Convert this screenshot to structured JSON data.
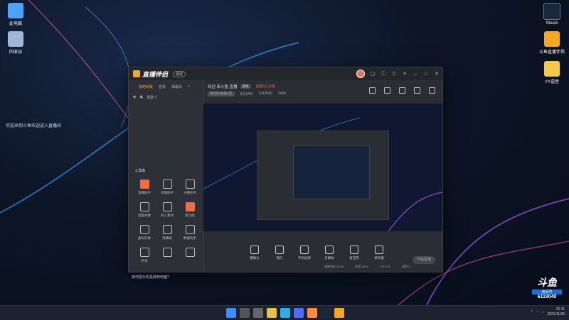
{
  "desktop": {
    "icons_left": [
      {
        "label": "此电脑",
        "icon": "computer-icon",
        "color": "#4aa3ff"
      },
      {
        "label": "回收站",
        "icon": "recycle-bin-icon",
        "color": "#9fb8d8"
      }
    ],
    "icons_right": [
      {
        "label": "Steam",
        "icon": "steam-icon",
        "color": "#1b2838"
      },
      {
        "label": "斗鱼直播伴侣",
        "icon": "douyu-icon",
        "color": "#f5a623"
      },
      {
        "label": "YY语音",
        "icon": "yy-icon",
        "color": "#f6c945"
      }
    ],
    "welcome_text": "欢迎来到斗鱼欢迎进入直播间"
  },
  "app": {
    "title": "直播伴侣",
    "version": "测试",
    "left_tabs": [
      "我的场景",
      "音效",
      "弹幕库"
    ],
    "scene_label": "场景 1",
    "tools_heading": "工具箱",
    "tools": [
      {
        "label": "直播助手",
        "hot": true
      },
      {
        "label": "房管助手",
        "hot": false
      },
      {
        "label": "主播任务",
        "hot": false
      },
      {
        "label": "电脑录像",
        "hot": false
      },
      {
        "label": "导入素材",
        "hot": false
      },
      {
        "label": "新功能",
        "hot": true
      },
      {
        "label": "虚拟形象",
        "hot": false
      },
      {
        "label": "弹幕姬",
        "hot": false
      },
      {
        "label": "数据助手",
        "hot": false
      },
      {
        "label": "更多",
        "hot": false
      },
      {
        "label": "",
        "hot": false
      },
      {
        "label": "",
        "hot": false
      }
    ],
    "notice": "如何把手机投屏到电脑?",
    "room_title": "欢迎 来斗鱼 直播",
    "room_tag": "游戏",
    "room_tag_red": "直播间未开播",
    "meta": [
      "请选择直播分区",
      "4月18日",
      "6119040",
      "2405"
    ],
    "bottom_buttons": [
      "摄像头",
      "窗口",
      "手机投屏",
      "多媒体",
      "麦克风",
      "扬声器"
    ],
    "start_label": "开始直播",
    "status": [
      "直播时长 00:00",
      "码率 0kb/s",
      "CPU 0%",
      "帧率 0"
    ]
  },
  "badge": {
    "brand": "斗鱼",
    "tag": "房间号",
    "room_no": "6119040"
  },
  "taskbar": {
    "clock_time": "20:11",
    "clock_date": "2021/11/30"
  }
}
